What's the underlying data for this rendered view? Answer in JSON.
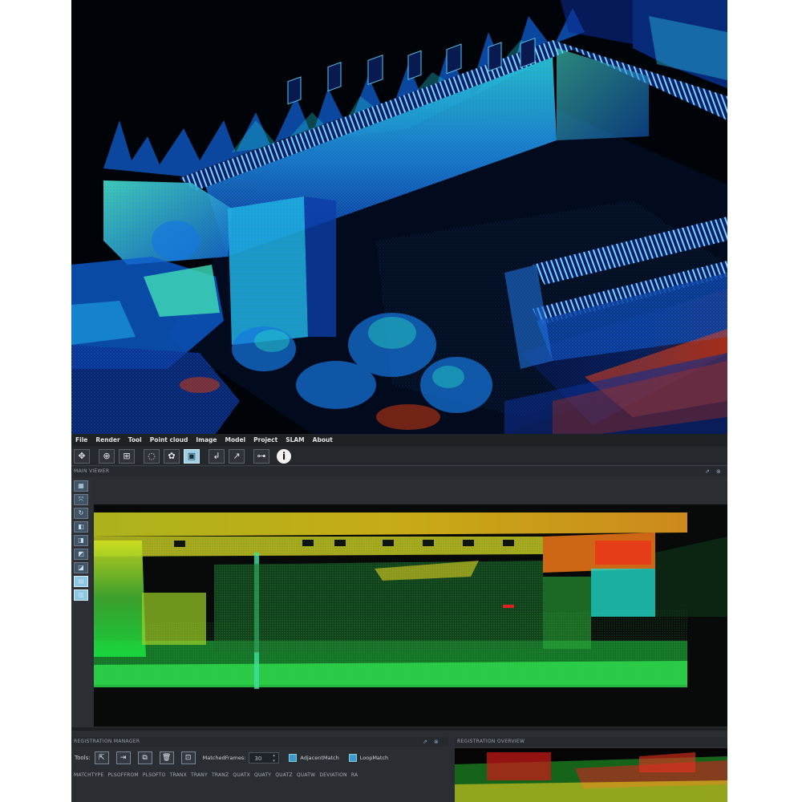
{
  "app": {
    "menu": [
      "File",
      "Render",
      "Tool",
      "Point cloud",
      "Image",
      "Model",
      "Project",
      "SLAM",
      "About"
    ],
    "toolbar": [
      {
        "icon": "select-pick-icon"
      },
      {
        "icon": "zoom-region-icon"
      },
      {
        "icon": "zoom-fit-icon"
      },
      {
        "icon": "lasso-icon"
      },
      {
        "icon": "color-mode-icon"
      },
      {
        "icon": "display-mode-icon",
        "active": true
      },
      {
        "icon": "import-icon"
      },
      {
        "icon": "export-icon"
      },
      {
        "icon": "network-icon"
      },
      {
        "icon": "info-icon"
      }
    ],
    "main_viewer": {
      "title": "MAIN VIEWER"
    },
    "left_tools": [
      {
        "icon": "grid-view-icon"
      },
      {
        "icon": "expand-icon"
      },
      {
        "icon": "rotate-icon"
      },
      {
        "icon": "cube-front-icon"
      },
      {
        "icon": "cube-back-icon"
      },
      {
        "icon": "cube-left-icon"
      },
      {
        "icon": "cube-right-icon"
      },
      {
        "icon": "cube-top-icon"
      },
      {
        "icon": "cube-bottom-icon"
      }
    ],
    "registration": {
      "title": "REGISTRATION MANAGER",
      "tools_label": "Tools:",
      "tool_icons": [
        "add-frame-icon",
        "apply-icon",
        "merge-icon",
        "delete-icon",
        "link-icon"
      ],
      "matched_frames_label": "MatchedFrames:",
      "matched_frames_value": "30",
      "adjacent_match_label": "AdjacentMatch",
      "loop_match_label": "LoopMatch",
      "columns": [
        "MATCHTYPE",
        "PLSOFFROM",
        "PLSOFTO",
        "TRANX",
        "TRANY",
        "TRANZ",
        "QUATX",
        "QUATY",
        "QUATZ",
        "QUATW",
        "DEVIATION",
        "RA"
      ]
    },
    "side_panel": {
      "title": "REGISTRATION OVERVIEW"
    }
  },
  "colors": {
    "background": "#000000",
    "panel": "#2a2d31",
    "menubar": "#1f2225",
    "accent": "#9fd0e6",
    "cloud_low": "#1030c8",
    "cloud_mid": "#20d0b0",
    "cloud_high": "#e03010",
    "viewer_yellow": "#e8d020",
    "viewer_green": "#30c040"
  }
}
